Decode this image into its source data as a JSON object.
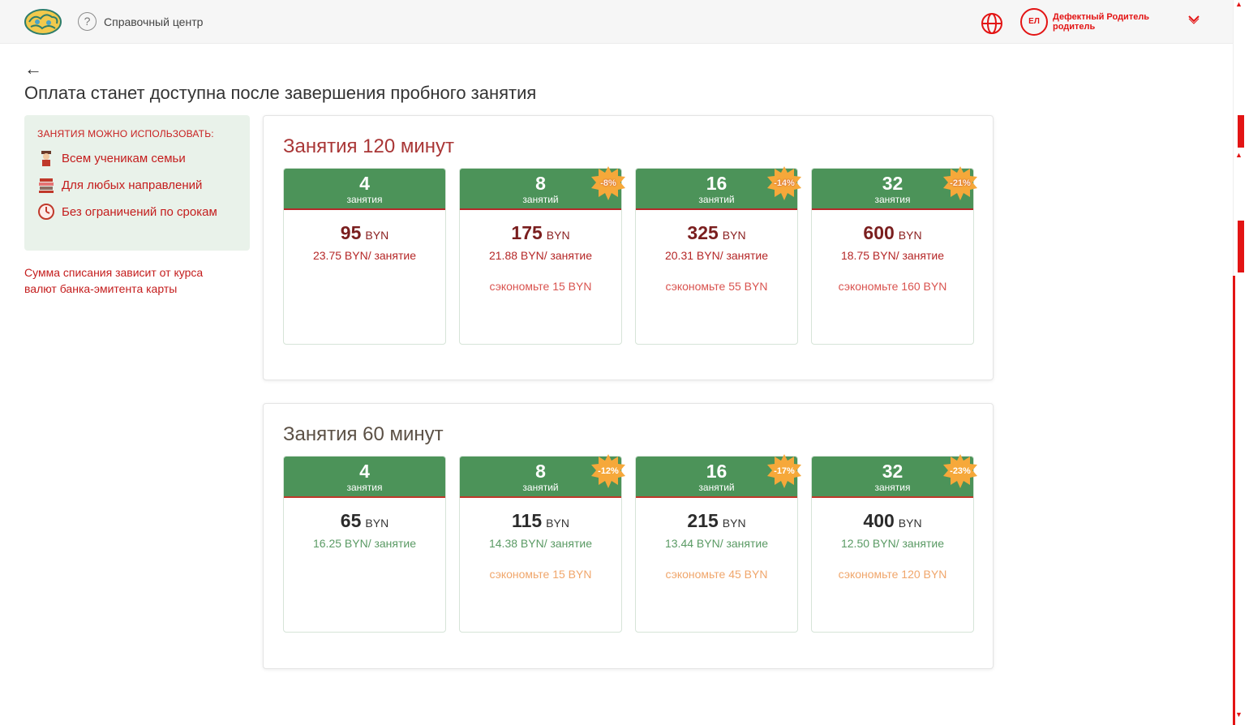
{
  "header": {
    "help_label": "Справочный центр",
    "help_symbol": "?",
    "user_avatar_text": "ЕЛ",
    "user_name": "Дефектный Родитель родитель"
  },
  "page": {
    "back_symbol": "←",
    "title": "Оплата станет доступна после завершения пробного занятия"
  },
  "info": {
    "heading": "Занятия можно использовать:",
    "items": [
      {
        "label": "Всем ученикам семьи",
        "icon": "student-icon"
      },
      {
        "label": "Для любых направлений",
        "icon": "books-icon"
      },
      {
        "label": "Без ограничений по срокам",
        "icon": "clock-icon"
      }
    ],
    "note": "Сумма списания зависит от курса валют банка-эмитента карты"
  },
  "colors": {
    "green": "#4c9359",
    "badge": "#f6a83a",
    "accent_red": "#e31414"
  },
  "plans": [
    {
      "title": "Занятия 120 минут",
      "cards": [
        {
          "count": "4",
          "unit": "занятия",
          "price": "95",
          "currency": "BYN",
          "per_lesson": "23.75 BYN/ занятие",
          "save": "",
          "discount": ""
        },
        {
          "count": "8",
          "unit": "занятий",
          "price": "175",
          "currency": "BYN",
          "per_lesson": "21.88 BYN/ занятие",
          "save": "сэкономьте 15 BYN",
          "discount": "-8%"
        },
        {
          "count": "16",
          "unit": "занятий",
          "price": "325",
          "currency": "BYN",
          "per_lesson": "20.31 BYN/ занятие",
          "save": "сэкономьте 55 BYN",
          "discount": "-14%"
        },
        {
          "count": "32",
          "unit": "занятия",
          "price": "600",
          "currency": "BYN",
          "per_lesson": "18.75 BYN/ занятие",
          "save": "сэкономьте 160 BYN",
          "discount": "-21%"
        }
      ]
    },
    {
      "title": "Занятия 60 минут",
      "cards": [
        {
          "count": "4",
          "unit": "занятия",
          "price": "65",
          "currency": "BYN",
          "per_lesson": "16.25 BYN/ занятие",
          "save": "",
          "discount": ""
        },
        {
          "count": "8",
          "unit": "занятий",
          "price": "115",
          "currency": "BYN",
          "per_lesson": "14.38 BYN/ занятие",
          "save": "сэкономьте 15 BYN",
          "discount": "-12%"
        },
        {
          "count": "16",
          "unit": "занятий",
          "price": "215",
          "currency": "BYN",
          "per_lesson": "13.44 BYN/ занятие",
          "save": "сэкономьте 45 BYN",
          "discount": "-17%"
        },
        {
          "count": "32",
          "unit": "занятия",
          "price": "400",
          "currency": "BYN",
          "per_lesson": "12.50 BYN/ занятие",
          "save": "сэкономьте 120 BYN",
          "discount": "-23%"
        }
      ]
    }
  ]
}
